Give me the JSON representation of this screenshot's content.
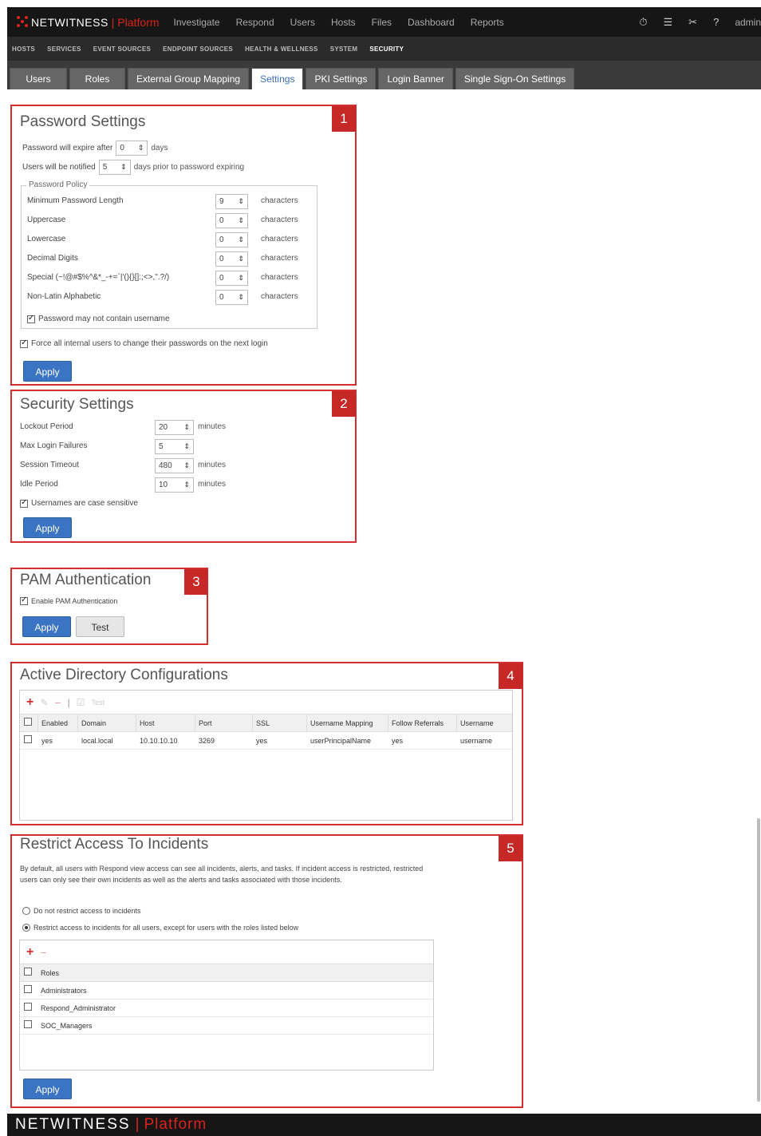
{
  "topnav": {
    "logo_text": "NETWITNESS",
    "logo_platform": "Platform",
    "menu": [
      "Investigate",
      "Respond",
      "Users",
      "Hosts",
      "Files",
      "Dashboard",
      "Reports"
    ],
    "user": "admin"
  },
  "subnav": [
    "HOSTS",
    "SERVICES",
    "EVENT SOURCES",
    "ENDPOINT SOURCES",
    "HEALTH & WELLNESS",
    "SYSTEM",
    "SECURITY"
  ],
  "tabs": [
    "Users",
    "Roles",
    "External Group Mapping",
    "Settings",
    "PKI Settings",
    "Login Banner",
    "Single Sign-On Settings"
  ],
  "callouts": [
    "1",
    "2",
    "3",
    "4",
    "5"
  ],
  "password": {
    "title": "Password Settings",
    "expire_label": "Password will expire after",
    "expire_value": "0",
    "expire_unit": "days",
    "notify_label": "Users will be notified",
    "notify_value": "5",
    "notify_unit": "days prior to password expiring",
    "policy_legend": "Password Policy",
    "policy_rows": [
      {
        "label": "Minimum Password Length",
        "value": "9",
        "unit": "characters"
      },
      {
        "label": "Uppercase",
        "value": "0",
        "unit": "characters"
      },
      {
        "label": "Lowercase",
        "value": "0",
        "unit": "characters"
      },
      {
        "label": "Decimal Digits",
        "value": "0",
        "unit": "characters"
      },
      {
        "label": "Special (~!@#$%^&*_-+=`|'(){}[]:;<>,\".?/)",
        "value": "0",
        "unit": "characters"
      },
      {
        "label": "Non-Latin Alphabetic",
        "value": "0",
        "unit": "characters"
      }
    ],
    "no_username": "Password may not contain username",
    "force_change": "Force all internal users to change their passwords on the next login",
    "apply": "Apply"
  },
  "security": {
    "title": "Security Settings",
    "rows": [
      {
        "label": "Lockout Period",
        "value": "20",
        "unit": "minutes"
      },
      {
        "label": "Max Login Failures",
        "value": "5",
        "unit": ""
      },
      {
        "label": "Session Timeout",
        "value": "480",
        "unit": "minutes"
      },
      {
        "label": "Idle Period",
        "value": "10",
        "unit": "minutes"
      }
    ],
    "case_sensitive": "Usernames are case sensitive",
    "apply": "Apply"
  },
  "pam": {
    "title": "PAM Authentication",
    "enable": "Enable PAM Authentication",
    "apply": "Apply",
    "test": "Test"
  },
  "ad": {
    "title": "Active Directory Configurations",
    "test": "Test",
    "columns": [
      "Enabled",
      "Domain",
      "Host",
      "Port",
      "SSL",
      "Username Mapping",
      "Follow Referrals",
      "Username"
    ],
    "rows": [
      [
        "yes",
        "local.local",
        "10.10.10.10",
        "3269",
        "yes",
        "userPrincipalName",
        "yes",
        "username"
      ]
    ]
  },
  "restrict": {
    "title": "Restrict Access To Incidents",
    "description": "By default, all users with Respond view access can see all incidents, alerts, and tasks. If incident access is restricted, restricted users can only see their own incidents as well as the alerts and tasks associated with those incidents.",
    "opt_none": "Do not restrict access to incidents",
    "opt_restrict": "Restrict access to incidents for all users, except for users with the roles listed below",
    "roles_header": "Roles",
    "roles": [
      "Administrators",
      "Respond_Administrator",
      "SOC_Managers"
    ],
    "apply": "Apply"
  },
  "footer": {
    "brand": "NETWITNESS",
    "platform": "Platform"
  },
  "colors": {
    "accent": "#3a74c2",
    "callout": "#c62828",
    "frame": "#d32f2f",
    "brand_red": "#d9231b"
  }
}
